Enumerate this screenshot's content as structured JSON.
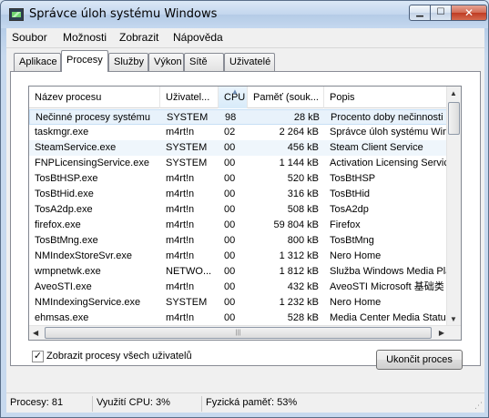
{
  "window": {
    "title": "Správce úloh systému Windows"
  },
  "menu": [
    "Soubor",
    "Možnosti",
    "Zobrazit",
    "Nápověda"
  ],
  "tabs": [
    "Aplikace",
    "Procesy",
    "Služby",
    "Výkon",
    "Sítě",
    "Uživatelé"
  ],
  "active_tab": "Procesy",
  "columns": [
    "Název procesu",
    "Uživatel...",
    "CPU",
    "Paměť (souk...",
    "Popis"
  ],
  "sorted_column": "CPU",
  "processes": [
    {
      "name": "Nečinné procesy systému",
      "user": "SYSTEM",
      "cpu": "98",
      "mem": "28 kB",
      "desc": "Procento doby nečinnosti p"
    },
    {
      "name": "taskmgr.exe",
      "user": "m4rt!n",
      "cpu": "02",
      "mem": "2 264 kB",
      "desc": "Správce úloh systému Wind"
    },
    {
      "name": "SteamService.exe",
      "user": "SYSTEM",
      "cpu": "00",
      "mem": "456 kB",
      "desc": "Steam Client Service"
    },
    {
      "name": "FNPLicensingService.exe",
      "user": "SYSTEM",
      "cpu": "00",
      "mem": "1 144 kB",
      "desc": "Activation Licensing Servic"
    },
    {
      "name": "TosBtHSP.exe",
      "user": "m4rt!n",
      "cpu": "00",
      "mem": "520 kB",
      "desc": "TosBtHSP"
    },
    {
      "name": "TosBtHid.exe",
      "user": "m4rt!n",
      "cpu": "00",
      "mem": "316 kB",
      "desc": "TosBtHid"
    },
    {
      "name": "TosA2dp.exe",
      "user": "m4rt!n",
      "cpu": "00",
      "mem": "508 kB",
      "desc": "TosA2dp"
    },
    {
      "name": "firefox.exe",
      "user": "m4rt!n",
      "cpu": "00",
      "mem": "59 804 kB",
      "desc": "Firefox"
    },
    {
      "name": "TosBtMng.exe",
      "user": "m4rt!n",
      "cpu": "00",
      "mem": "800 kB",
      "desc": "TosBtMng"
    },
    {
      "name": "NMIndexStoreSvr.exe",
      "user": "m4rt!n",
      "cpu": "00",
      "mem": "1 312 kB",
      "desc": "Nero Home"
    },
    {
      "name": "wmpnetwk.exe",
      "user": "NETWO...",
      "cpu": "00",
      "mem": "1 812 kB",
      "desc": "Služba Windows Media Play"
    },
    {
      "name": "AveoSTI.exe",
      "user": "m4rt!n",
      "cpu": "00",
      "mem": "432 kB",
      "desc": "AveoSTI Microsoft 基础类"
    },
    {
      "name": "NMIndexingService.exe",
      "user": "SYSTEM",
      "cpu": "00",
      "mem": "1 232 kB",
      "desc": "Nero Home"
    },
    {
      "name": "ehmsas.exe",
      "user": "m4rt!n",
      "cpu": "00",
      "mem": "528 kB",
      "desc": "Media Center Media Status"
    }
  ],
  "show_all_users": {
    "label": "Zobrazit procesy všech uživatelů",
    "checked": true
  },
  "end_process_button": "Ukončit proces",
  "status": {
    "processes": "Procesy: 81",
    "cpu": "Využití CPU: 3%",
    "memory": "Fyzická paměť: 53%"
  }
}
